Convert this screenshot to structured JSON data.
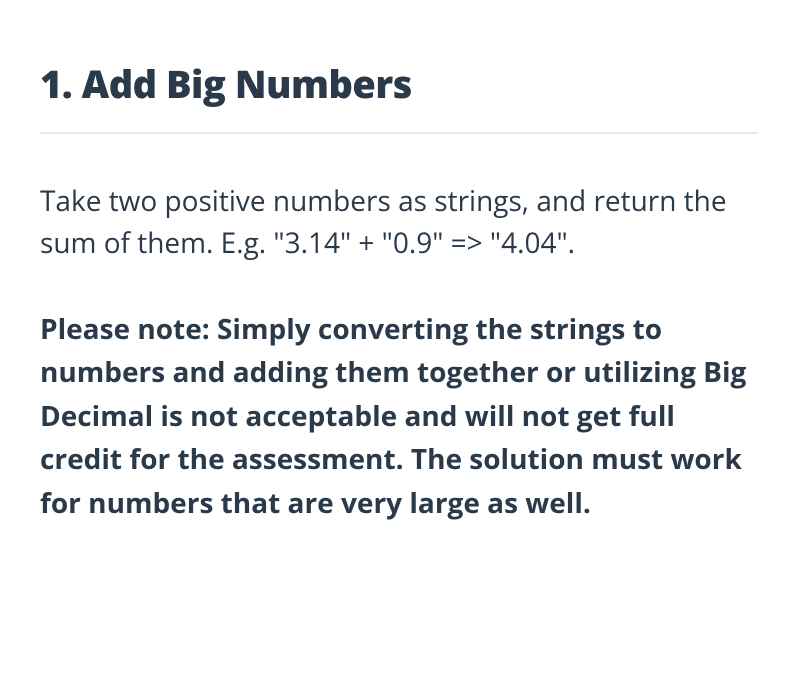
{
  "heading": "1. Add Big Numbers",
  "description": "Take two positive numbers as strings, and return the sum of them.  E.g. \"3.14\" + \"0.9\" => \"4.04\".",
  "note": "Please note: Simply converting the strings to numbers and adding them together or utilizing Big Decimal is not acceptable and will not get full credit for the assessment.  The solution must work for numbers that are very large as well."
}
